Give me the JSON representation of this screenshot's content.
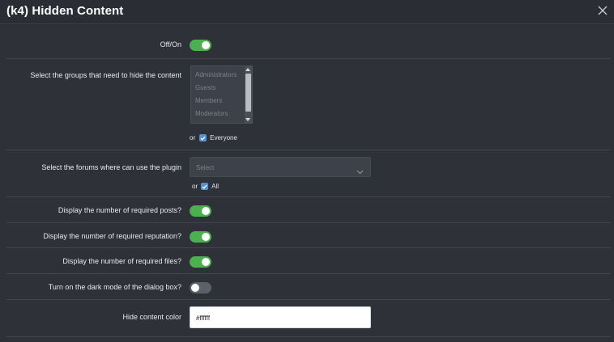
{
  "dialog": {
    "title": "(k4) Hidden Content"
  },
  "rows": {
    "toggle_main": {
      "label": "Off/On",
      "on": true
    },
    "groups": {
      "label": "Select the groups that need to hide the content",
      "options": [
        "Administrators",
        "Guests",
        "Members",
        "Moderators"
      ],
      "or_text": "or",
      "everyone_label": "Everyone",
      "everyone_checked": true
    },
    "forums": {
      "label": "Select the forums where can use the plugin",
      "placeholder": "Select",
      "or_text": "or",
      "all_label": "All",
      "all_checked": true
    },
    "posts": {
      "label": "Display the number of required posts?",
      "on": true
    },
    "reputation": {
      "label": "Display the number of required reputation?",
      "on": true
    },
    "files": {
      "label": "Display the number of required files?",
      "on": true
    },
    "dark_mode": {
      "label": "Turn on the dark mode of the dialog box?",
      "on": false
    },
    "color": {
      "label": "Hide content color",
      "value": "#ffffff"
    }
  },
  "colors": {
    "background": "#2e3138",
    "toggle_on": "#4caf50",
    "toggle_off": "#5c6069",
    "checkbox": "#5b8fc7"
  }
}
